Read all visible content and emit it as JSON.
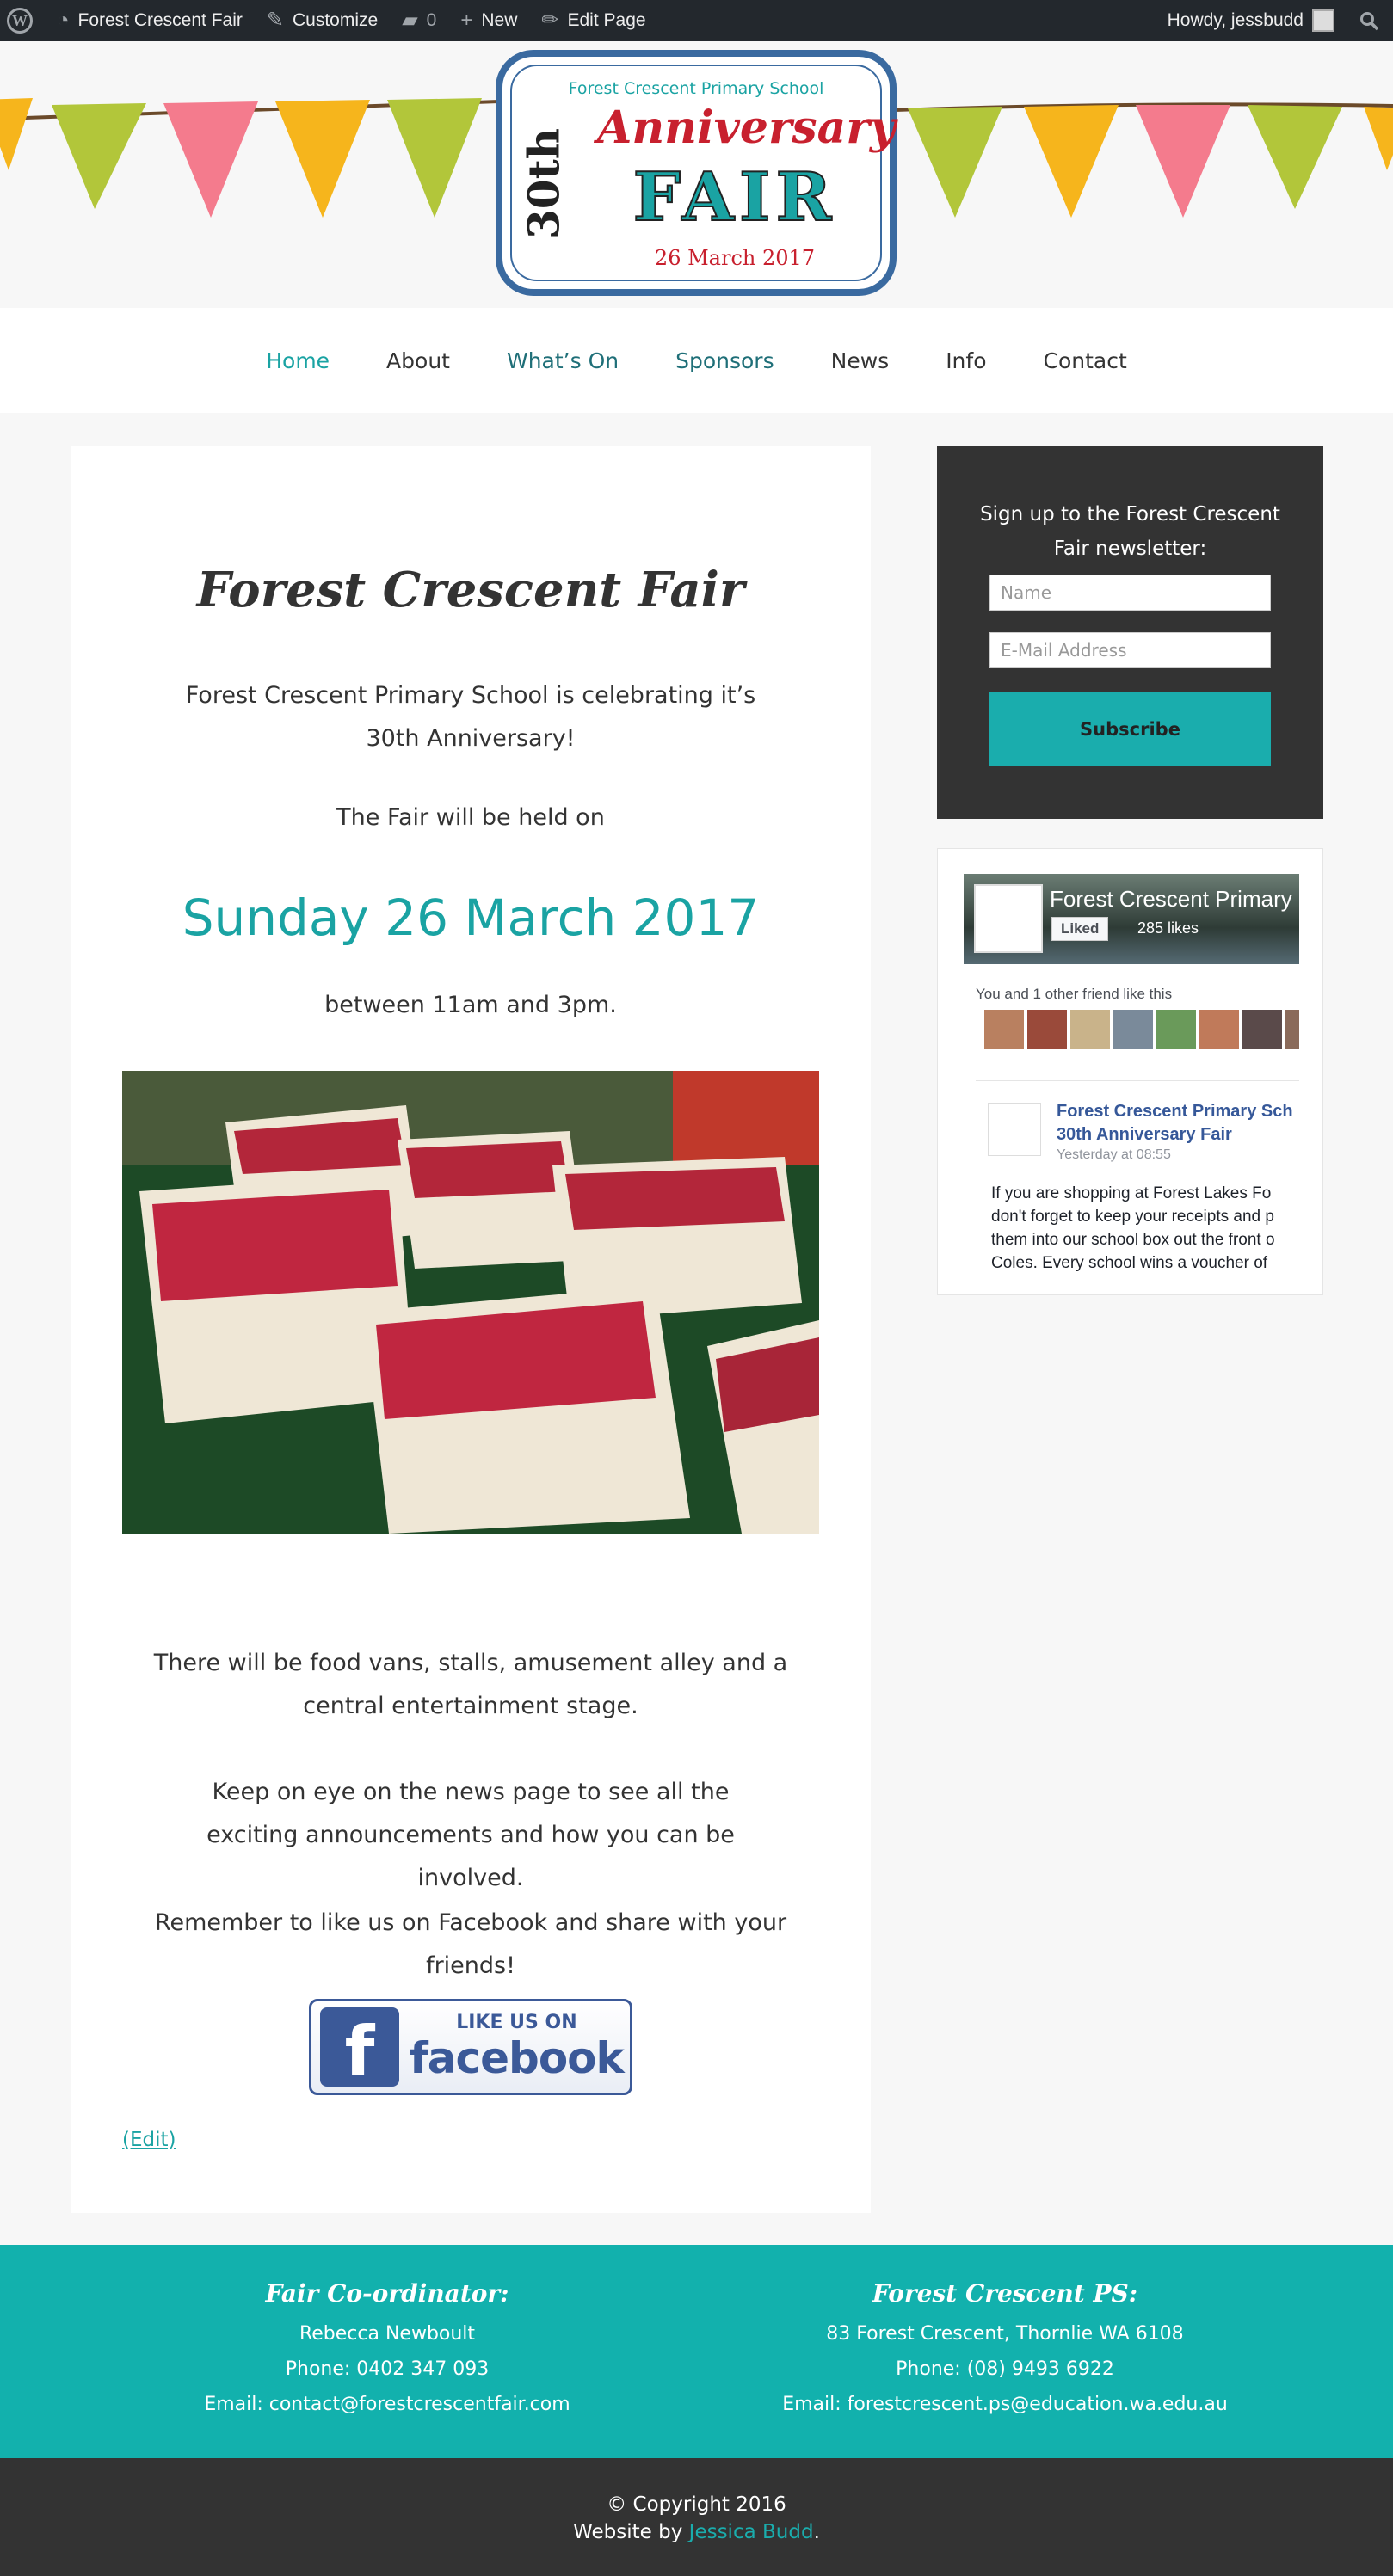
{
  "admin_bar": {
    "site_name": "Forest Crescent Fair",
    "customize": "Customize",
    "comments_count": "0",
    "new": "New",
    "edit_page": "Edit Page",
    "howdy": "Howdy, jessbudd"
  },
  "logo": {
    "school": "Forest Crescent Primary School",
    "ordinal": "30th",
    "anniversary": "Anniversary",
    "fair": "FAIR",
    "date": "26 March 2017"
  },
  "nav": {
    "items": [
      {
        "label": "Home"
      },
      {
        "label": "About"
      },
      {
        "label": "What’s On"
      },
      {
        "label": "Sponsors"
      },
      {
        "label": "News"
      },
      {
        "label": "Info"
      },
      {
        "label": "Contact"
      }
    ]
  },
  "main": {
    "title": "Forest Crescent Fair",
    "intro": "Forest Crescent Primary School is celebrating it’s 30th Anniversary!",
    "held_on": "The Fair will be held on",
    "date": "Sunday 26 March 2017",
    "time": "between 11am and 3pm.",
    "para1": "There will be food vans, stalls, amusement alley and a central entertainment stage.",
    "para2": "Keep on eye on the news page to see all the exciting announcements and how you can be involved.",
    "para3": "Remember to like us on Facebook and share with your friends!",
    "fb_like_on": "LIKE US ON",
    "fb_word": "facebook",
    "edit": "(Edit)"
  },
  "newsletter": {
    "title": "Sign up to the Forest Crescent Fair newsletter:",
    "name_placeholder": "Name",
    "email_placeholder": "E-Mail Address",
    "button": "Subscribe"
  },
  "fb_widget": {
    "page_name": "Forest Crescent Primary",
    "liked": "Liked",
    "likes": "285 likes",
    "friends": "You and 1 other friend like this",
    "post_title_1": "Forest Crescent Primary Sch",
    "post_title_2": "30th Anniversary Fair",
    "post_time": "Yesterday at 08:55",
    "post_body_1": "If you are shopping at Forest Lakes Fo",
    "post_body_2": "don't forget to keep your receipts and p",
    "post_body_3": "them into our school box out the front o",
    "post_body_4": "Coles. Every school wins a voucher of"
  },
  "footer": {
    "col1": {
      "heading": "Fair Co-ordinator:",
      "name": "Rebecca Newboult",
      "phone": "Phone: 0402 347 093",
      "email": "Email: contact@forestcrescentfair.com"
    },
    "col2": {
      "heading": "Forest Crescent PS:",
      "address": "83 Forest Crescent, Thornlie WA 6108",
      "phone": "Phone: (08) 9493 6922",
      "email": "Email: forestcrescent.ps@education.wa.edu.au"
    },
    "copyright": "© Copyright 2016",
    "website_by": "Website by",
    "author": "Jessica Budd",
    "period": "."
  },
  "colors": {
    "accent": "#1aa3a3",
    "footer": "#12b1ad",
    "dark": "#333333"
  }
}
